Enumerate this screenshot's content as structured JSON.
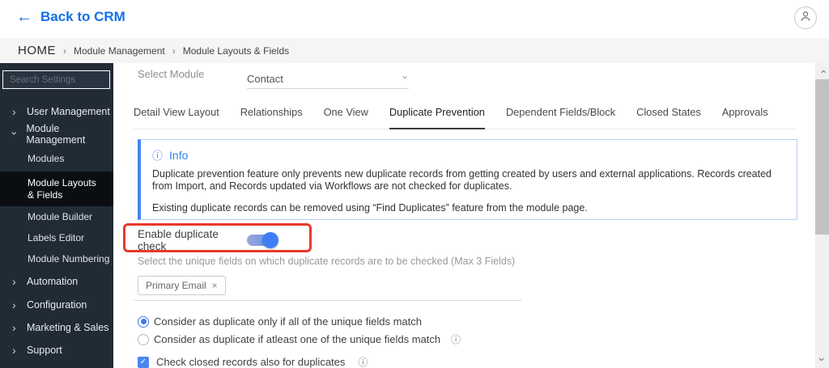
{
  "icons": {
    "back_arrow": "←",
    "chevron": "›",
    "close": "×",
    "check": "✓",
    "info": "ⓘ"
  },
  "topbar": {
    "back_label": "Back to CRM"
  },
  "breadcrumb": {
    "home": "HOME",
    "separator": "›",
    "items": [
      "Module Management",
      "Module Layouts & Fields"
    ]
  },
  "sidebar": {
    "search_placeholder": "Search Settings",
    "parents": [
      {
        "label": "User Management",
        "expanded": false
      },
      {
        "label": "Module Management",
        "expanded": true
      },
      {
        "label": "Automation",
        "expanded": false
      },
      {
        "label": "Configuration",
        "expanded": false
      },
      {
        "label": "Marketing & Sales",
        "expanded": false
      },
      {
        "label": "Support",
        "expanded": false
      }
    ],
    "module_management_children": [
      {
        "label": "Modules",
        "selected": false
      },
      {
        "label": "Module Layouts & Fields",
        "selected": true
      },
      {
        "label": "Module Builder",
        "selected": false
      },
      {
        "label": "Labels Editor",
        "selected": false
      },
      {
        "label": "Module Numbering",
        "selected": false
      }
    ]
  },
  "main": {
    "select_module_label": "Select Module",
    "module_select": {
      "value": "Contact"
    },
    "tabs": [
      "Detail View Layout",
      "Relationships",
      "One View",
      "Duplicate Prevention",
      "Dependent Fields/Block",
      "Closed States",
      "Approvals"
    ],
    "active_tab": "Duplicate Prevention",
    "info_box": {
      "title": "Info",
      "paragraph1": "Duplicate prevention feature only prevents new duplicate records from getting created by users and external applications. Records created from Import, and Records updated via Workflows are not checked for duplicates.",
      "paragraph2": "Existing duplicate records can be removed using “Find Duplicates” feature from the module page."
    },
    "enable_duplicate": {
      "label": "Enable duplicate check",
      "state": "on"
    },
    "unique_fields_hint": "Select the unique fields on which duplicate records are to be checked (Max 3 Fields)",
    "selected_fields": [
      {
        "label": "Primary Email"
      }
    ],
    "match_options": [
      {
        "label": "Consider as duplicate only if all of the unique fields match",
        "selected": true
      },
      {
        "label": "Consider as duplicate if atleast one of the unique fields match",
        "selected": false
      }
    ],
    "closed_records_checkbox": {
      "label": "Check closed records also for duplicates",
      "checked": true
    }
  },
  "colors": {
    "accent_blue": "#1371e8",
    "toggle_blue": "#3f7ef5",
    "annotation_red": "#e8382c",
    "sidebar_bg": "#212b36",
    "sidebar_selected_bg": "#0a0e13",
    "info_border_blue": "#4584f2",
    "info_title_blue": "#2d7ff2"
  }
}
